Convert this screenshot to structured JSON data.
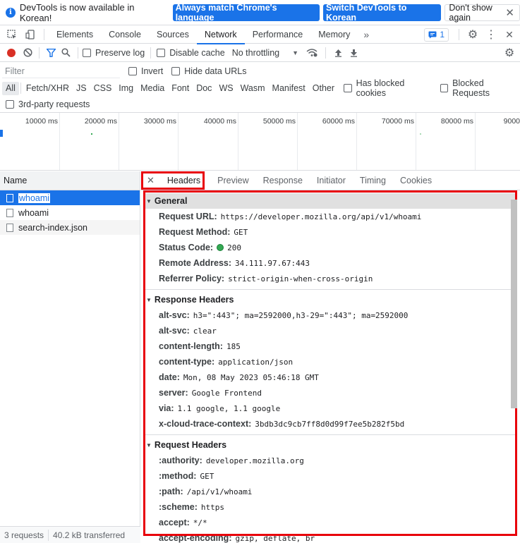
{
  "infobar": {
    "message": "DevTools is now available in Korean!",
    "btn_match": "Always match Chrome's language",
    "btn_switch": "Switch DevTools to Korean",
    "btn_dismiss": "Don't show again"
  },
  "panels": [
    "Elements",
    "Console",
    "Sources",
    "Network",
    "Performance",
    "Memory"
  ],
  "issues_count": "1",
  "toolbar": {
    "preserve_log": "Preserve log",
    "disable_cache": "Disable cache",
    "throttling": "No throttling"
  },
  "filter": {
    "placeholder": "Filter",
    "invert": "Invert",
    "hide_data_urls": "Hide data URLs"
  },
  "types": [
    "All",
    "Fetch/XHR",
    "JS",
    "CSS",
    "Img",
    "Media",
    "Font",
    "Doc",
    "WS",
    "Wasm",
    "Manifest",
    "Other"
  ],
  "blocked_cookies": "Has blocked cookies",
  "blocked_requests": "Blocked Requests",
  "third_party": "3rd-party requests",
  "timeline_labels": [
    "10000 ms",
    "20000 ms",
    "30000 ms",
    "40000 ms",
    "50000 ms",
    "60000 ms",
    "70000 ms",
    "80000 ms",
    "9000"
  ],
  "requests": {
    "header": "Name",
    "items": [
      "whoami",
      "whoami",
      "search-index.json"
    ],
    "status_count": "3 requests",
    "status_transferred": "40.2 kB transferred"
  },
  "detail_tabs": [
    "Headers",
    "Preview",
    "Response",
    "Initiator",
    "Timing",
    "Cookies"
  ],
  "general": {
    "title": "General",
    "rows": [
      {
        "k": "Request URL:",
        "v": "https://developer.mozilla.org/api/v1/whoami"
      },
      {
        "k": "Request Method:",
        "v": "GET"
      },
      {
        "k": "Status Code:",
        "v": "200"
      },
      {
        "k": "Remote Address:",
        "v": "34.111.97.67:443"
      },
      {
        "k": "Referrer Policy:",
        "v": "strict-origin-when-cross-origin"
      }
    ]
  },
  "response_headers": {
    "title": "Response Headers",
    "rows": [
      {
        "k": "alt-svc:",
        "v": "h3=\":443\"; ma=2592000,h3-29=\":443\"; ma=2592000"
      },
      {
        "k": "alt-svc:",
        "v": "clear"
      },
      {
        "k": "content-length:",
        "v": "185"
      },
      {
        "k": "content-type:",
        "v": "application/json"
      },
      {
        "k": "date:",
        "v": "Mon, 08 May 2023 05:46:18 GMT"
      },
      {
        "k": "server:",
        "v": "Google Frontend"
      },
      {
        "k": "via:",
        "v": "1.1 google, 1.1 google"
      },
      {
        "k": "x-cloud-trace-context:",
        "v": "3bdb3dc9cb7ff8d0d99f7ee5b282f5bd"
      }
    ]
  },
  "request_headers": {
    "title": "Request Headers",
    "rows": [
      {
        "k": ":authority:",
        "v": "developer.mozilla.org"
      },
      {
        "k": ":method:",
        "v": "GET"
      },
      {
        "k": ":path:",
        "v": "/api/v1/whoami"
      },
      {
        "k": ":scheme:",
        "v": "https"
      },
      {
        "k": "accept:",
        "v": "*/*"
      },
      {
        "k": "accept-encoding:",
        "v": "gzip, deflate, br"
      }
    ]
  }
}
